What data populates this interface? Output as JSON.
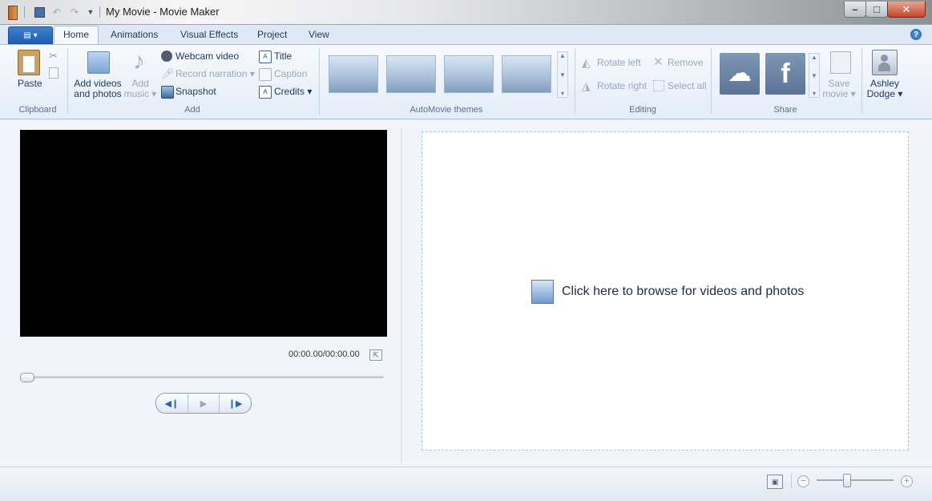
{
  "window": {
    "title": "My Movie - Movie Maker",
    "minimize": "–",
    "maximize": "□",
    "close": "✕"
  },
  "tabs": [
    {
      "label": "Home",
      "selected": true
    },
    {
      "label": "Animations"
    },
    {
      "label": "Visual Effects"
    },
    {
      "label": "Project"
    },
    {
      "label": "View"
    }
  ],
  "help": "?",
  "ribbon": {
    "clipboard": {
      "paste": "Paste",
      "group_label": "Clipboard"
    },
    "add": {
      "add_videos_line1": "Add videos",
      "add_videos_line2": "and photos",
      "add_music_line1": "Add",
      "add_music_line2": "music ▾",
      "webcam": "Webcam video",
      "record_narration": "Record narration ▾",
      "snapshot": "Snapshot",
      "title": "Title",
      "caption": "Caption",
      "credits": "Credits ▾",
      "group_label": "Add"
    },
    "automovie": {
      "group_label": "AutoMovie themes"
    },
    "editing": {
      "rotate_left": "Rotate left",
      "rotate_right": "Rotate right",
      "remove": "Remove",
      "select_all": "Select all",
      "group_label": "Editing"
    },
    "share": {
      "save_movie_line1": "Save",
      "save_movie_line2": "movie ▾",
      "group_label": "Share"
    },
    "account": {
      "name_line1": "Ashley",
      "name_line2": "Dodge ▾"
    }
  },
  "preview": {
    "timecode": "00:00.00/00:00.00",
    "prev_frame": "◀❙",
    "play": "▶",
    "next_frame": "❙▶"
  },
  "storyboard": {
    "browse_text": "Click here to browse for videos and photos"
  },
  "statusbar": {
    "zoom_out": "−",
    "zoom_in": "+",
    "zoom_level": 0.4
  }
}
